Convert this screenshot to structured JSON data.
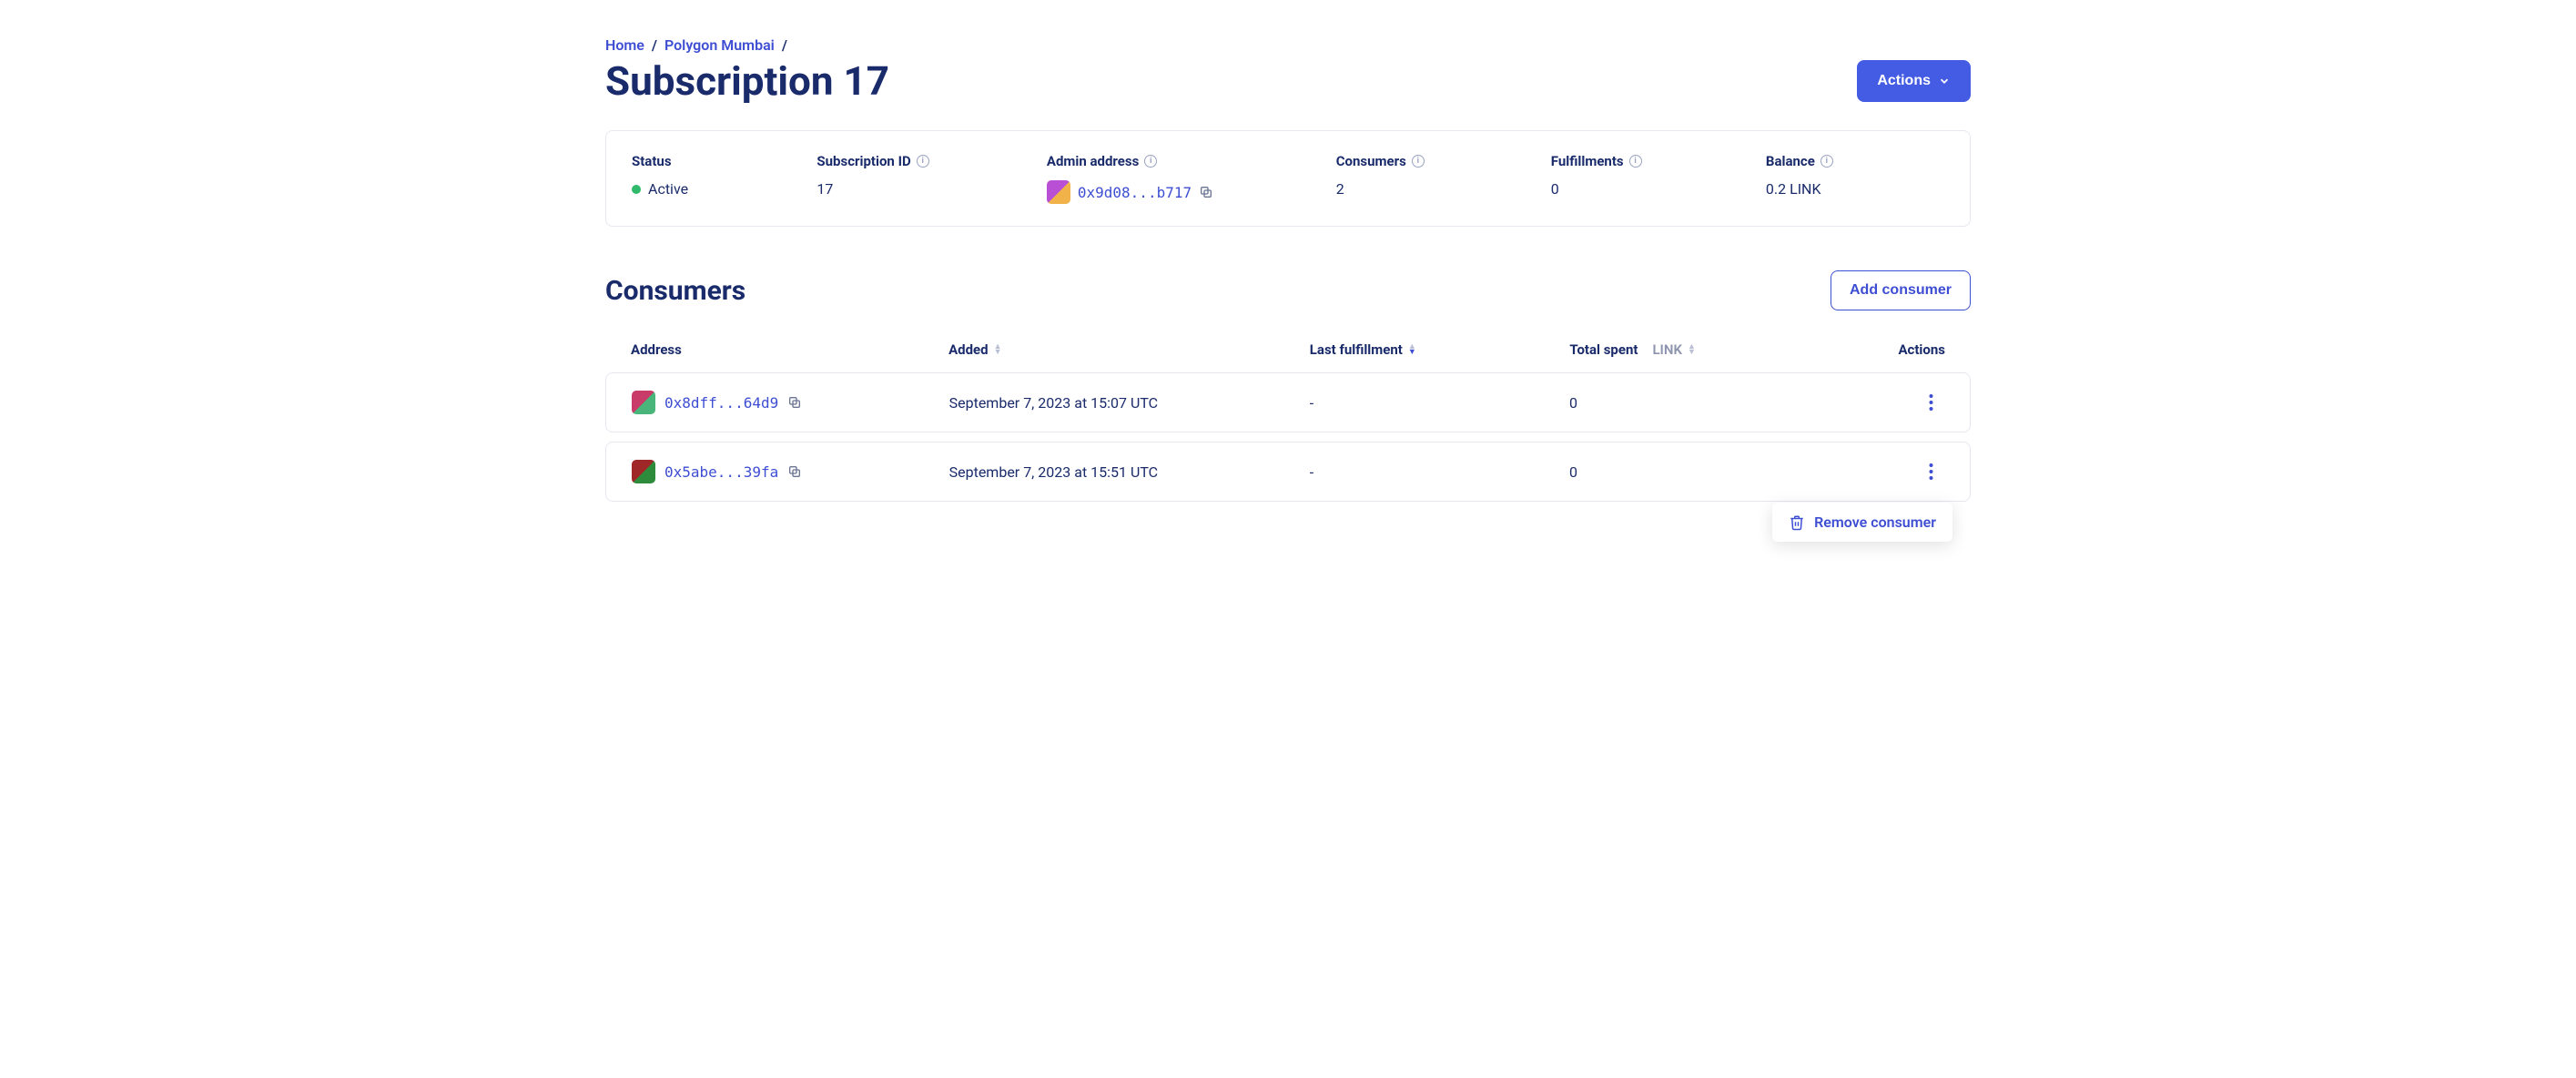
{
  "breadcrumbs": {
    "home": "Home",
    "network": "Polygon Mumbai"
  },
  "page_title": "Subscription 17",
  "actions_button": "Actions",
  "stats": {
    "status_label": "Status",
    "status_value": "Active",
    "sub_id_label": "Subscription ID",
    "sub_id_value": "17",
    "admin_label": "Admin address",
    "admin_value": "0x9d08...b717",
    "consumers_label": "Consumers",
    "consumers_value": "2",
    "fulfillments_label": "Fulfillments",
    "fulfillments_value": "0",
    "balance_label": "Balance",
    "balance_value": "0.2 LINK"
  },
  "consumers_section": {
    "title": "Consumers",
    "add_button": "Add consumer",
    "columns": {
      "address": "Address",
      "added": "Added",
      "last_fulfillment": "Last fulfillment",
      "total_spent": "Total spent",
      "total_spent_unit": "LINK",
      "actions": "Actions"
    },
    "rows": [
      {
        "address": "0x8dff...64d9",
        "added": "September 7, 2023 at 15:07 UTC",
        "last_fulfillment": "-",
        "total_spent": "0"
      },
      {
        "address": "0x5abe...39fa",
        "added": "September 7, 2023 at 15:51 UTC",
        "last_fulfillment": "-",
        "total_spent": "0"
      }
    ],
    "popover_label": "Remove consumer"
  }
}
